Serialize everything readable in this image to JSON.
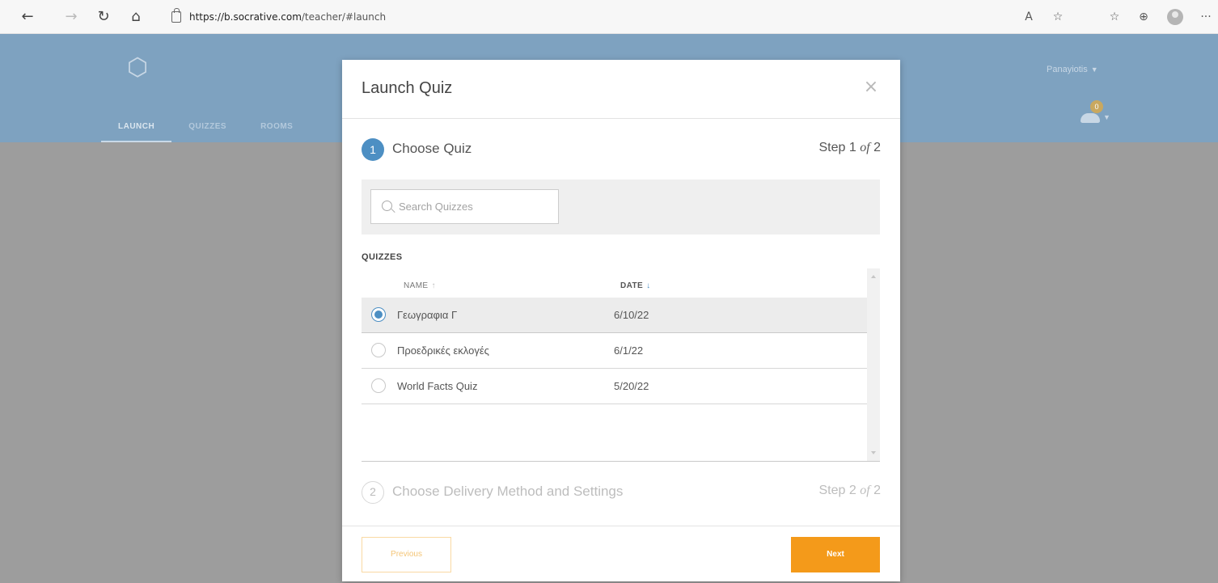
{
  "browser": {
    "back_icon": "←",
    "forward_icon": "→",
    "refresh_icon": "↻",
    "home_icon": "⌂",
    "url_host": "https://b.socrative.com",
    "url_path": "/teacher/#launch",
    "read_aloud_icon": "A",
    "favorites_add_icon": "☆",
    "favorites_icon": "☆",
    "collections_icon": "⊕",
    "more_icon": "···"
  },
  "app": {
    "logo_icon": "⬡",
    "nav": [
      {
        "label": "LAUNCH",
        "active": true
      },
      {
        "label": "QUIZZES",
        "active": false
      },
      {
        "label": "ROOMS",
        "active": false
      }
    ],
    "user_name": "Panayiotis",
    "user_chevron": "▼",
    "notif_count": "0",
    "notif_chevron": "▼"
  },
  "modal": {
    "title": "Launch Quiz",
    "close_icon": "×",
    "step1": {
      "number": "1",
      "label": "Choose Quiz",
      "count_prefix": "Step 1 ",
      "count_of": "of",
      "count_total": " 2"
    },
    "search": {
      "placeholder": "Search Quizzes",
      "value": ""
    },
    "quizzes_heading": "QUIZZES",
    "columns": {
      "name": "NAME",
      "name_sort_icon": "↑",
      "date": "DATE",
      "date_sort_icon": "↓"
    },
    "rows": [
      {
        "name": "Γεωγραφια Γ",
        "date": "6/10/22",
        "selected": true
      },
      {
        "name": "Προεδρικές εκλογές",
        "date": "6/1/22",
        "selected": false
      },
      {
        "name": "World Facts Quiz",
        "date": "5/20/22",
        "selected": false
      }
    ],
    "step2": {
      "number": "2",
      "label": "Choose Delivery Method and Settings",
      "count_prefix": "Step 2 ",
      "count_of": "of",
      "count_total": " 2"
    },
    "previous_label": "Previous",
    "next_label": "Next"
  },
  "colors": {
    "accent_blue": "#4d8fc3",
    "next_orange": "#f49a1a",
    "header_blue_dimmed": "#7ea2c0"
  }
}
